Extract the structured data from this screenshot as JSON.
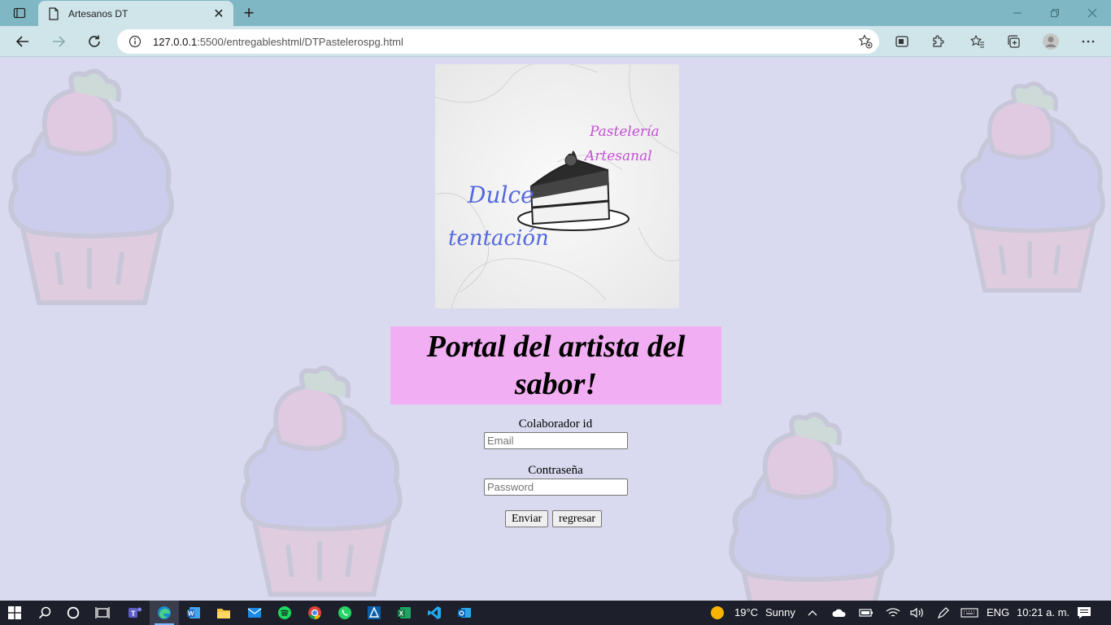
{
  "browser": {
    "tab_title": "Artesanos DT",
    "url_host": "127.0.0.1",
    "url_rest": ":5500/entregableshtml/DTPastelerospg.html"
  },
  "page": {
    "logo": {
      "line1": "Pastelería",
      "line2": "Artesanal",
      "brand1": "Dulce",
      "brand2": "tentación"
    },
    "heading": "Portal del artista del sabor!",
    "form": {
      "id_label": "Colaborador id",
      "email_placeholder": "Email",
      "password_label": "Contraseña",
      "password_placeholder": "Password",
      "submit_label": "Enviar",
      "back_label": "regresar"
    }
  },
  "taskbar": {
    "weather_temp": "19°C",
    "weather_text": "Sunny",
    "language": "ENG",
    "clock": "10:21 a. m."
  },
  "colors": {
    "page_background": "#d9d9ef",
    "heading_background": "#f2aef2",
    "brand_blue": "#5468e0",
    "brand_purple": "#c44fd6"
  }
}
